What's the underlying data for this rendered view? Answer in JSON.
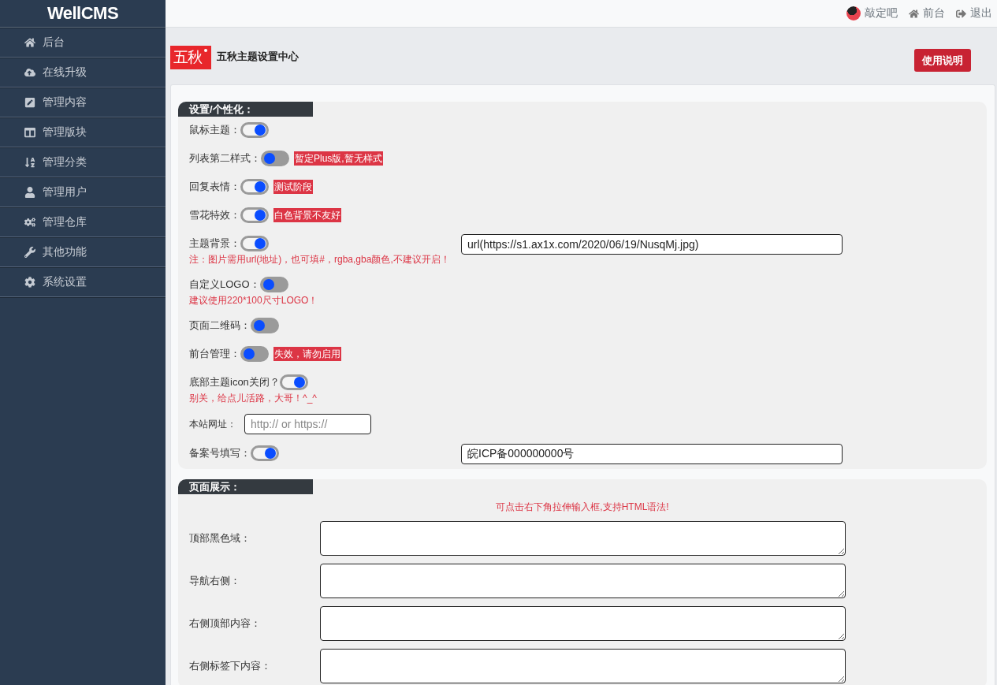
{
  "sidebar": {
    "logo": "WellCMS",
    "items": [
      "后台",
      "在线升级",
      "管理内容",
      "管理版块",
      "管理分类",
      "管理用户",
      "管理仓库",
      "其他功能",
      "系统设置"
    ]
  },
  "topbar": {
    "user": "敲定吧",
    "links": [
      "前台",
      "退出"
    ]
  },
  "header": {
    "logo": "五秋",
    "title": "五秋主题设置中心",
    "help_button": "使用说明"
  },
  "sections": [
    {
      "title": "设置/个性化：",
      "rows": [
        {
          "kind": "toggle",
          "label": "鼠标主题：",
          "on": true
        },
        {
          "kind": "toggle",
          "label": "列表第二样式：",
          "on": false,
          "badge": "暂定Plus版,暂无样式"
        },
        {
          "kind": "toggle",
          "label": "回复表情：",
          "on": true,
          "badge": "测试阶段"
        },
        {
          "kind": "toggle",
          "label": "雪花特效：",
          "on": true,
          "badge": "白色背景不友好"
        },
        {
          "kind": "toggle",
          "label": "主题背景：",
          "on": true,
          "note": "注：图片需用url(地址)，也可填#，rgba,gba颜色,不建议开启！",
          "input": {
            "value": "url(https://s1.ax1x.com/2020/06/19/NusqMj.jpg)"
          }
        },
        {
          "kind": "toggle",
          "label": "自定义LOGO：",
          "on": false,
          "note": "建议使用220*100尺寸LOGO！"
        },
        {
          "kind": "toggle",
          "label": "页面二维码：",
          "on": false
        },
        {
          "kind": "toggle",
          "label": "前台管理：",
          "on": false,
          "badge": "失效，请勿启用"
        },
        {
          "kind": "toggle",
          "label": "底部主题icon关闭？",
          "on": true,
          "note": "别关，给点儿活路，大哥！^_^"
        },
        {
          "kind": "text",
          "label": "本站网址：",
          "input": {
            "placeholder": "http:// or https://"
          }
        },
        {
          "kind": "toggle",
          "label": "备案号填写：",
          "on": true,
          "input": {
            "value": "皖ICP备000000000号"
          }
        }
      ]
    },
    {
      "title": "页面展示：",
      "hint": "可点击右下角拉伸输入框,支持HTML语法!",
      "rows": [
        {
          "kind": "textarea",
          "label": "顶部黑色域："
        },
        {
          "kind": "textarea",
          "label": "导航右侧："
        },
        {
          "kind": "textarea",
          "label": "右侧顶部内容："
        },
        {
          "kind": "textarea",
          "label": "右侧标签下内容："
        }
      ]
    }
  ]
}
